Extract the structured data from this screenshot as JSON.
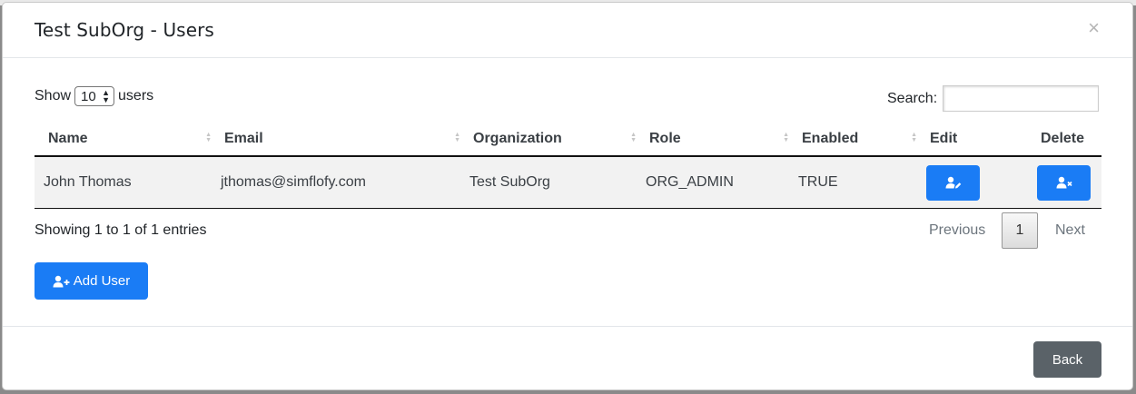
{
  "modal": {
    "title": "Test SubOrg - Users",
    "close_icon": "×"
  },
  "length_control": {
    "prefix": "Show",
    "value": "10",
    "suffix": "users"
  },
  "search": {
    "label": "Search:",
    "value": ""
  },
  "table": {
    "columns": [
      "Name",
      "Email",
      "Organization",
      "Role",
      "Enabled",
      "Edit",
      "Delete"
    ],
    "rows": [
      {
        "name": "John Thomas",
        "email": "jthomas@simflofy.com",
        "organization": "Test SubOrg",
        "role": "ORG_ADMIN",
        "enabled": "TRUE",
        "edit_icon": "user-edit-icon",
        "delete_icon": "user-remove-icon"
      }
    ]
  },
  "info_text": "Showing 1 to 1 of 1 entries",
  "pagination": {
    "previous": "Previous",
    "current_page": "1",
    "next": "Next"
  },
  "add_user_label": "Add User",
  "footer": {
    "back_label": "Back"
  },
  "colors": {
    "primary": "#1a7cf5",
    "secondary": "#5a6268"
  }
}
